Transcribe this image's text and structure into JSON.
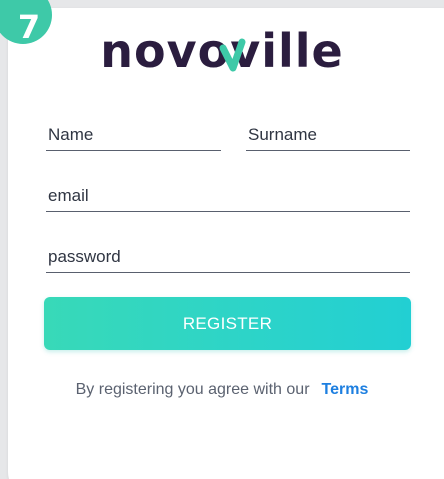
{
  "step": {
    "number": "7"
  },
  "brand": {
    "logo_text": "novoville",
    "logo_color": "#2b1d3f",
    "accent_color": "#3ec9a8"
  },
  "form": {
    "name_placeholder": "Name",
    "surname_placeholder": "Surname",
    "email_placeholder": "email",
    "password_placeholder": "password",
    "register_label": "REGISTER"
  },
  "terms": {
    "prefix": "By registering you agree with our",
    "link_label": "Terms",
    "link_color": "#1d7fe0"
  }
}
